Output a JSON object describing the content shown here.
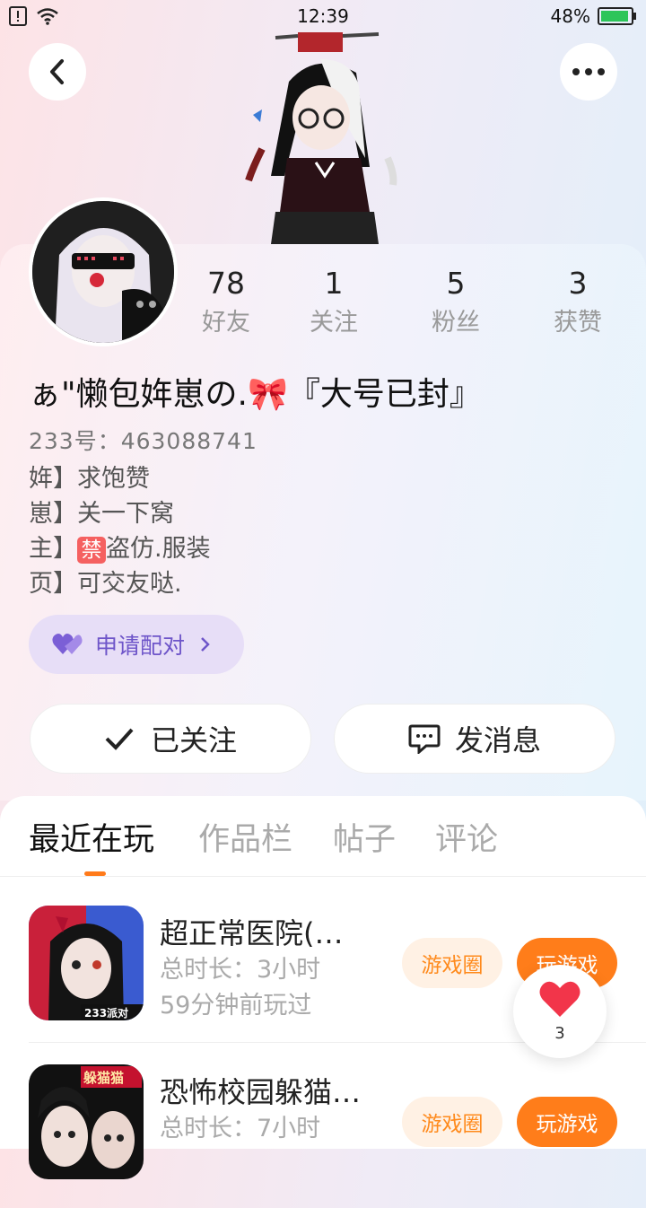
{
  "status_bar": {
    "time": "12:39",
    "battery": "48%",
    "battery_level": 0.48
  },
  "profile": {
    "nickname": "ぁ\"懒包姩崽の.🎀『大号已封』",
    "uid": "233号：463088741",
    "bio": [
      "姩】求饱赞",
      "崽】关一下窝",
      "主】",
      "页】可交友哒."
    ],
    "bio_ban_badge": "禁",
    "bio_line3_rest": "盗仿.服装"
  },
  "stats": [
    {
      "value": "78",
      "label": "好友"
    },
    {
      "value": "1",
      "label": "关注"
    },
    {
      "value": "5",
      "label": "粉丝"
    },
    {
      "value": "3",
      "label": "获赞"
    }
  ],
  "pair_button": "申请配对",
  "actions": {
    "follow": "已关注",
    "message": "发消息"
  },
  "tabs": [
    "最近在玩",
    "作品栏",
    "帖子",
    "评论"
  ],
  "games": [
    {
      "name": "超正常医院(…",
      "total": "总时长：3小时",
      "last": "59分钟前玩过",
      "circle": "游戏圈",
      "play": "玩游戏",
      "icon_badge": "233派对"
    },
    {
      "name": "恐怖校园躲猫…",
      "total": "总时长：7小时",
      "last": "",
      "circle": "游戏圈",
      "play": "玩游戏",
      "icon_badge": "躲猫猫"
    }
  ],
  "like_float": {
    "count": "3"
  },
  "colors": {
    "accent": "#ff7d1a",
    "pair": "#6e55c9"
  }
}
